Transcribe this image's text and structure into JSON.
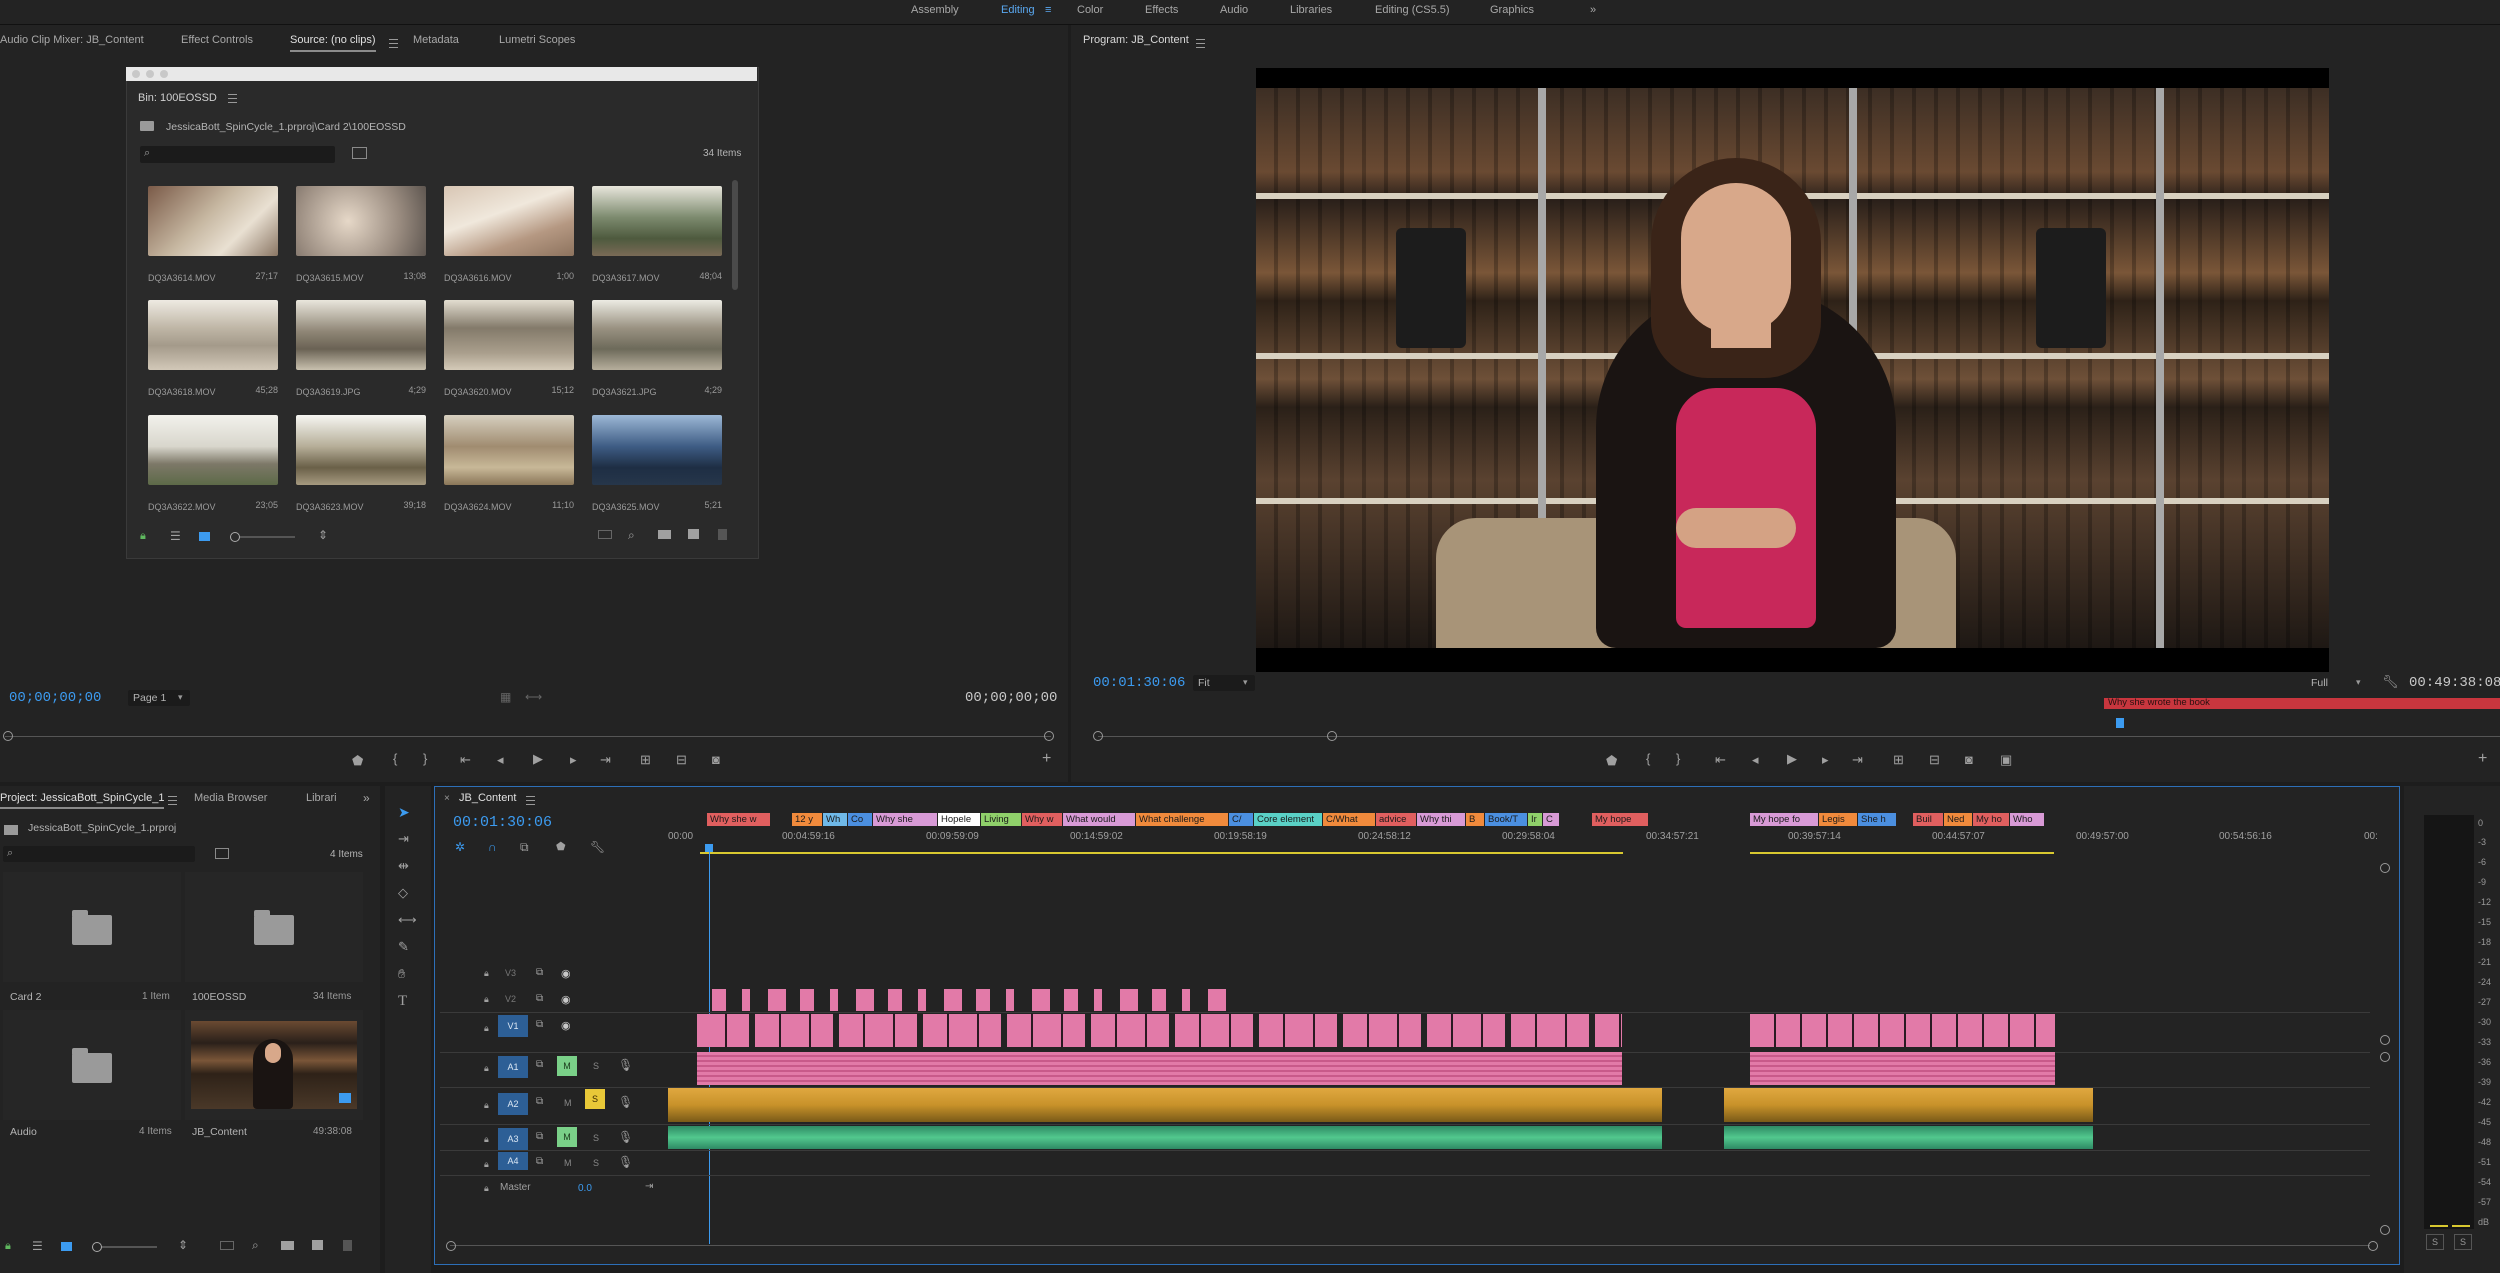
{
  "workspaces": {
    "items": [
      "Assembly",
      "Editing",
      "Color",
      "Effects",
      "Audio",
      "Libraries",
      "Editing (CS5.5)",
      "Graphics"
    ],
    "active": "Editing",
    "overflow": "»"
  },
  "source_panel": {
    "tabs": [
      "Audio Clip Mixer: JB_Content",
      "Effect Controls",
      "Source: (no clips)",
      "Metadata",
      "Lumetri Scopes"
    ],
    "active_tab": "Source: (no clips)",
    "timecode_left": "00;00;00;00",
    "page": "Page 1",
    "timecode_right": "00;00;00;00"
  },
  "bin": {
    "title": "Bin: 100EOSSD",
    "path": "JessicaBott_SpinCycle_1.prproj\\Card 2\\100EOSSD",
    "count": "34 Items",
    "items": [
      {
        "name": "DQ3A3614.MOV",
        "dur": "27;17"
      },
      {
        "name": "DQ3A3615.MOV",
        "dur": "13;08"
      },
      {
        "name": "DQ3A3616.MOV",
        "dur": "1;00"
      },
      {
        "name": "DQ3A3617.MOV",
        "dur": "48;04"
      },
      {
        "name": "DQ3A3618.MOV",
        "dur": "45;28"
      },
      {
        "name": "DQ3A3619.JPG",
        "dur": "4;29"
      },
      {
        "name": "DQ3A3620.MOV",
        "dur": "15;12"
      },
      {
        "name": "DQ3A3621.JPG",
        "dur": "4;29"
      },
      {
        "name": "DQ3A3622.MOV",
        "dur": "23;05"
      },
      {
        "name": "DQ3A3623.MOV",
        "dur": "39;18"
      },
      {
        "name": "DQ3A3624.MOV",
        "dur": "11;10"
      },
      {
        "name": "DQ3A3625.MOV",
        "dur": "5;21"
      }
    ]
  },
  "program_panel": {
    "title": "Program: JB_Content",
    "timecode": "00:01:30:06",
    "fit": "Fit",
    "quality": "Full",
    "duration": "00:49:38:08",
    "marker_label": "Why she wrote the book"
  },
  "project_panel": {
    "tabs": [
      "Project: JessicaBott_SpinCycle_1",
      "Media Browser",
      "Librari"
    ],
    "project_file": "JessicaBott_SpinCycle_1.prproj",
    "count": "4 Items",
    "items": [
      {
        "name": "Card 2",
        "info": "1 Item"
      },
      {
        "name": "100EOSSD",
        "info": "34 Items"
      },
      {
        "name": "Audio",
        "info": "4 Items"
      },
      {
        "name": "JB_Content",
        "info": "49:38:08"
      }
    ]
  },
  "timeline": {
    "tab": "JB_Content",
    "timecode": "00:01:30:06",
    "ruler": [
      "00:00",
      "00:04:59:16",
      "00:09:59:09",
      "00:14:59:02",
      "00:19:58:19",
      "00:24:58:12",
      "00:29:58:04",
      "00:34:57:21",
      "00:39:57:14",
      "00:44:57:07",
      "00:49:57:00",
      "00:54:56:16",
      "00:"
    ],
    "tracks": [
      {
        "id": "V3",
        "label": "V3"
      },
      {
        "id": "V2",
        "label": "V2"
      },
      {
        "id": "V1",
        "label": "V1"
      },
      {
        "id": "A1",
        "label": "A1",
        "m": "M",
        "s": "S"
      },
      {
        "id": "A2",
        "label": "A2",
        "m": "M",
        "s": "S"
      },
      {
        "id": "A3",
        "label": "A3",
        "m": "M",
        "s": "S"
      },
      {
        "id": "A4",
        "label": "A4",
        "m": "M",
        "s": "S"
      }
    ],
    "master_label": "Master",
    "master_value": "0.0",
    "markers": [
      {
        "text": "Why she w",
        "color": "#e05f5f"
      },
      {
        "text": "12 y",
        "color": "#f08a3c"
      },
      {
        "text": "Wh",
        "color": "#6fb9e8"
      },
      {
        "text": "Co",
        "color": "#4b8fe0"
      },
      {
        "text": "Why she",
        "color": "#d89ad6"
      },
      {
        "text": "Hopele",
        "color": "#ffffff"
      },
      {
        "text": "Living",
        "color": "#8fd06a"
      },
      {
        "text": "Why w",
        "color": "#e05f5f"
      },
      {
        "text": "What would",
        "color": "#d89ad6"
      },
      {
        "text": "What challenge",
        "color": "#f08a3c"
      },
      {
        "text": "C/",
        "color": "#4b8fe0"
      },
      {
        "text": "Core element",
        "color": "#5ad1c6"
      },
      {
        "text": "C/What",
        "color": "#f08a3c"
      },
      {
        "text": "advice",
        "color": "#e05f5f"
      },
      {
        "text": "Why thi",
        "color": "#d89ad6"
      },
      {
        "text": "B",
        "color": "#f08a3c"
      },
      {
        "text": "Book/T",
        "color": "#4b8fe0"
      },
      {
        "text": "Ir",
        "color": "#8fd06a"
      },
      {
        "text": "C",
        "color": "#d89ad6"
      },
      {
        "text": "My hope",
        "color": "#e05f5f"
      },
      {
        "text": "My hope fo",
        "color": "#d89ad6"
      },
      {
        "text": "Legis",
        "color": "#f08a3c"
      },
      {
        "text": "She h",
        "color": "#4b8fe0"
      },
      {
        "text": "Buil",
        "color": "#e05f5f"
      },
      {
        "text": "Ned",
        "color": "#f08a3c"
      },
      {
        "text": "My ho",
        "color": "#e05f5f"
      },
      {
        "text": "Who",
        "color": "#d89ad6"
      }
    ]
  },
  "audio_meter": {
    "ticks": [
      "0",
      "-3",
      "-6",
      "-9",
      "-12",
      "-15",
      "-18",
      "-21",
      "-24",
      "-27",
      "-30",
      "-33",
      "-36",
      "-39",
      "-42",
      "-45",
      "-48",
      "-51",
      "-54",
      "-57",
      "dB"
    ],
    "solo": [
      "S",
      "S"
    ]
  },
  "colors": {
    "accent_blue": "#3c9bf0",
    "video_clip": "#e27aa8",
    "audio_orange": "#d8a43a",
    "audio_green": "#3fb085"
  }
}
